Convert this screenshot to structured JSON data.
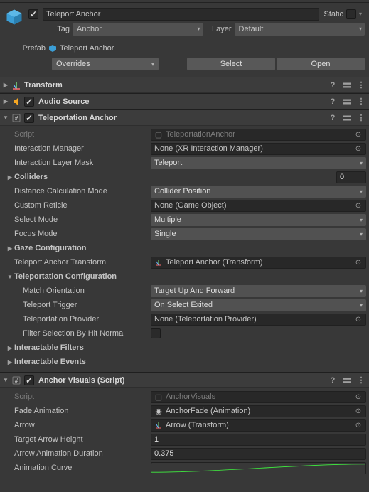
{
  "header": {
    "name": "Teleport Anchor",
    "static_label": "Static",
    "tag_label": "Tag",
    "tag_value": "Anchor",
    "layer_label": "Layer",
    "layer_value": "Default",
    "prefab_label": "Prefab",
    "prefab_value": "Teleport Anchor",
    "overrides_label": "Overrides",
    "select_label": "Select",
    "open_label": "Open"
  },
  "components": {
    "transform": {
      "title": "Transform"
    },
    "audio": {
      "title": "Audio Source"
    },
    "teleportation": {
      "title": "Teleportation Anchor",
      "script_label": "Script",
      "script_value": "TeleportationAnchor",
      "interaction_manager_label": "Interaction Manager",
      "interaction_manager_value": "None (XR Interaction Manager)",
      "interaction_layer_mask_label": "Interaction Layer Mask",
      "interaction_layer_mask_value": "Teleport",
      "colliders_label": "Colliders",
      "colliders_value": "0",
      "distance_calc_label": "Distance Calculation Mode",
      "distance_calc_value": "Collider Position",
      "custom_reticle_label": "Custom Reticle",
      "custom_reticle_value": "None (Game Object)",
      "select_mode_label": "Select Mode",
      "select_mode_value": "Multiple",
      "focus_mode_label": "Focus Mode",
      "focus_mode_value": "Single",
      "gaze_config_label": "Gaze Configuration",
      "anchor_transform_label": "Teleport Anchor Transform",
      "anchor_transform_value": "Teleport Anchor (Transform)",
      "teleport_config_label": "Teleportation Configuration",
      "match_orientation_label": "Match Orientation",
      "match_orientation_value": "Target Up And Forward",
      "teleport_trigger_label": "Teleport Trigger",
      "teleport_trigger_value": "On Select Exited",
      "teleport_provider_label": "Teleportation Provider",
      "teleport_provider_value": "None (Teleportation Provider)",
      "filter_selection_label": "Filter Selection By Hit Normal",
      "interactable_filters_label": "Interactable Filters",
      "interactable_events_label": "Interactable Events"
    },
    "anchor_visuals": {
      "title": "Anchor Visuals (Script)",
      "script_label": "Script",
      "script_value": "AnchorVisuals",
      "fade_anim_label": "Fade Animation",
      "fade_anim_value": "AnchorFade (Animation)",
      "arrow_label": "Arrow",
      "arrow_value": "Arrow (Transform)",
      "target_arrow_height_label": "Target Arrow Height",
      "target_arrow_height_value": "1",
      "arrow_anim_duration_label": "Arrow Animation Duration",
      "arrow_anim_duration_value": "0.375",
      "animation_curve_label": "Animation Curve"
    }
  }
}
